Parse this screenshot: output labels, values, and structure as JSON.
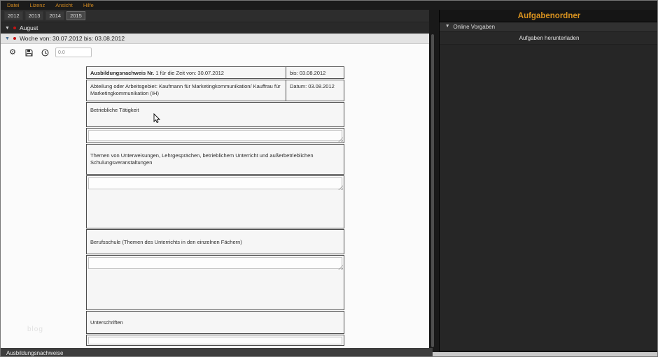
{
  "menu": {
    "items": [
      {
        "label": "Datei"
      },
      {
        "label": "Lizenz"
      },
      {
        "label": "Ansicht"
      },
      {
        "label": "Hilfe"
      }
    ]
  },
  "year_tabs": {
    "tabs": [
      {
        "label": "2012"
      },
      {
        "label": "2013"
      },
      {
        "label": "2014"
      },
      {
        "label": "2015",
        "selected": true
      }
    ]
  },
  "outline": {
    "month": {
      "label": "August"
    },
    "week": {
      "label": "Woche von: 30.07.2012 bis: 03.08.2012"
    }
  },
  "toolbar": {
    "icons": [
      {
        "name": "gear-icon"
      },
      {
        "name": "save-icon"
      },
      {
        "name": "clock-icon"
      }
    ],
    "hours_input": {
      "value": "0.0"
    }
  },
  "form": {
    "header": {
      "title_bold": "Ausbildungsnachweis Nr.",
      "title_rest": " 1 für die Zeit von: 30.07.2012",
      "bis": "bis: 03.08.2012",
      "abteilung": "Abteilung oder Arbeitsgebiet: Kaufmann für Marketingkommunikation/ Kauffrau für Marketingkommunikation (IH)",
      "datum": "Datum: 03.08.2012"
    },
    "sections": [
      {
        "label": "Betriebliche Tätigkeit",
        "value": ""
      },
      {
        "label": "Themen von Unterweisungen, Lehrgesprächen, betrieblichem Unterricht und außerbetrieblichen Schulungsveranstaltungen",
        "value": ""
      },
      {
        "label": "Berufsschule (Themen des Unterrichts in den einzelnen Fächern)",
        "value": ""
      },
      {
        "label": "Unterschriften",
        "value": ""
      }
    ]
  },
  "right_panel": {
    "title": "Aufgabenordner",
    "group": {
      "label": "Online Vorgaben"
    },
    "download_button": {
      "label": "Aufgaben herunterladen"
    }
  },
  "status_bar": {
    "text": "Ausbildungsnachweise"
  },
  "watermark": "blog",
  "colors": {
    "accent_orange": "#cd861f",
    "alert_red": "#c31414",
    "week_triangle_blue": "#4a7196",
    "panel_dark": "#262626",
    "menubar_dark": "#1b1b1b"
  }
}
